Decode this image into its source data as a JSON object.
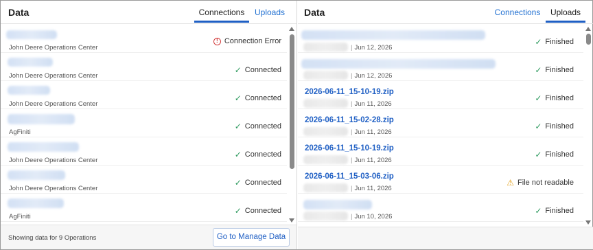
{
  "left_panel": {
    "title": "Data",
    "tabs": [
      {
        "label": "Connections",
        "active": true
      },
      {
        "label": "Uploads",
        "active": false
      }
    ],
    "rows": [
      {
        "source": "John Deere Operations Center",
        "status": "Connection Error",
        "status_type": "error"
      },
      {
        "source": "John Deere Operations Center",
        "status": "Connected",
        "status_type": "ok"
      },
      {
        "source": "John Deere Operations Center",
        "status": "Connected",
        "status_type": "ok"
      },
      {
        "source": "AgFiniti",
        "status": "Connected",
        "status_type": "ok"
      },
      {
        "source": "John Deere Operations Center",
        "status": "Connected",
        "status_type": "ok"
      },
      {
        "source": "John Deere Operations Center",
        "status": "Connected",
        "status_type": "ok"
      },
      {
        "source": "AgFiniti",
        "status": "Connected",
        "status_type": "ok"
      }
    ],
    "footer_text": "Showing data for 9 Operations",
    "manage_button": "Go to Manage Data"
  },
  "right_panel": {
    "title": "Data",
    "tabs": [
      {
        "label": "Connections",
        "active": false
      },
      {
        "label": "Uploads",
        "active": true
      }
    ],
    "rows": [
      {
        "file": "",
        "date": "Jun 12, 2026",
        "status": "Finished",
        "status_type": "ok"
      },
      {
        "file": "",
        "date": "Jun 12, 2026",
        "status": "Finished",
        "status_type": "ok"
      },
      {
        "file": "2026-06-11_15-10-19.zip",
        "date": "Jun 11, 2026",
        "status": "Finished",
        "status_type": "ok"
      },
      {
        "file": "2026-06-11_15-02-28.zip",
        "date": "Jun 11, 2026",
        "status": "Finished",
        "status_type": "ok"
      },
      {
        "file": "2026-06-11_15-10-19.zip",
        "date": "Jun 11, 2026",
        "status": "Finished",
        "status_type": "ok"
      },
      {
        "file": "2026-06-11_15-03-06.zip",
        "date": "Jun 11, 2026",
        "status": "File not readable",
        "status_type": "warning"
      },
      {
        "file": "",
        "date": "Jun 10, 2026",
        "status": "Finished",
        "status_type": "ok"
      }
    ]
  },
  "colors": {
    "accent": "#1f5fc4",
    "ok": "#2e9a5f",
    "error": "#d23b3b",
    "warning": "#e4a11b"
  },
  "icons": {
    "ok": "check-icon",
    "error": "error-circle-icon",
    "warning": "warning-triangle-icon"
  }
}
